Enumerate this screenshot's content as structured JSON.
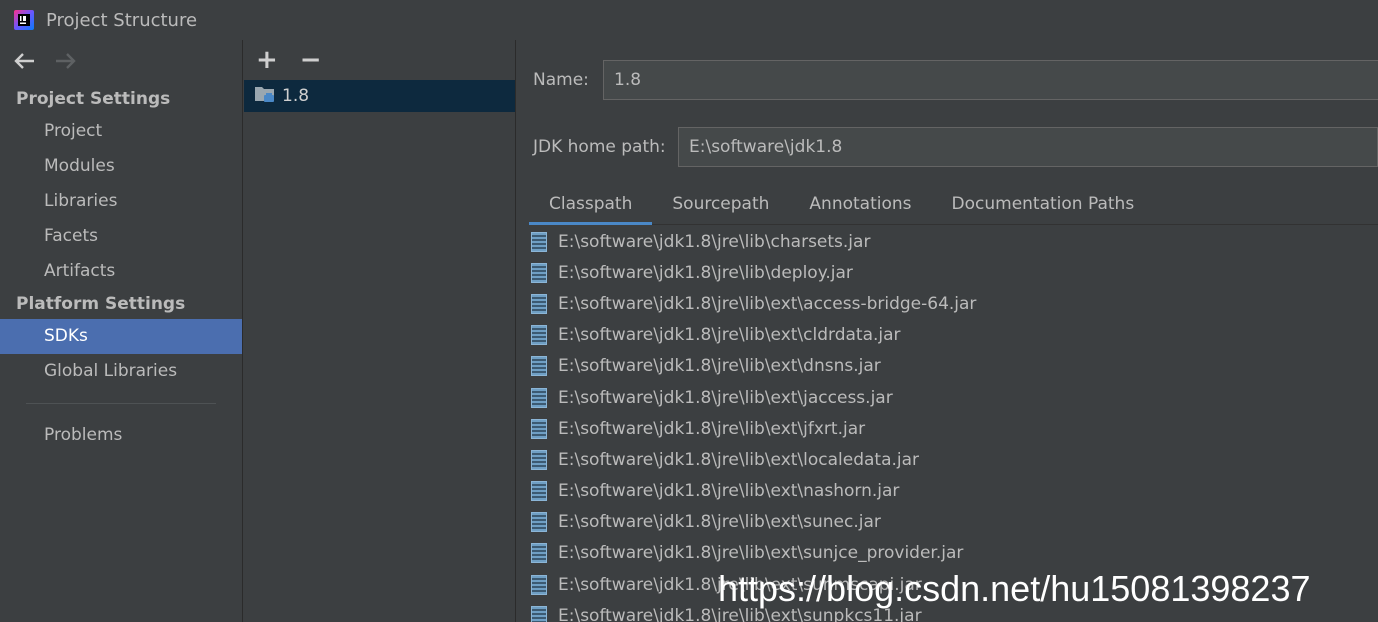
{
  "window": {
    "title": "Project Structure"
  },
  "nav": {
    "back_icon": "arrow-left-icon",
    "forward_icon": "arrow-right-icon",
    "project_settings_label": "Project Settings",
    "project_items": [
      "Project",
      "Modules",
      "Libraries",
      "Facets",
      "Artifacts"
    ],
    "platform_settings_label": "Platform Settings",
    "platform_items": [
      "SDKs",
      "Global Libraries"
    ],
    "selected": "SDKs",
    "problems_label": "Problems"
  },
  "sdk_list": {
    "add_label": "+",
    "remove_label": "−",
    "items": [
      "1.8"
    ]
  },
  "details": {
    "name_label": "Name:",
    "name_value": "1.8",
    "jdk_home_label": "JDK home path:",
    "jdk_home_value": "E:\\software\\jdk1.8"
  },
  "tabs": [
    "Classpath",
    "Sourcepath",
    "Annotations",
    "Documentation Paths"
  ],
  "active_tab": "Classpath",
  "classpath": [
    "E:\\software\\jdk1.8\\jre\\lib\\charsets.jar",
    "E:\\software\\jdk1.8\\jre\\lib\\deploy.jar",
    "E:\\software\\jdk1.8\\jre\\lib\\ext\\access-bridge-64.jar",
    "E:\\software\\jdk1.8\\jre\\lib\\ext\\cldrdata.jar",
    "E:\\software\\jdk1.8\\jre\\lib\\ext\\dnsns.jar",
    "E:\\software\\jdk1.8\\jre\\lib\\ext\\jaccess.jar",
    "E:\\software\\jdk1.8\\jre\\lib\\ext\\jfxrt.jar",
    "E:\\software\\jdk1.8\\jre\\lib\\ext\\localedata.jar",
    "E:\\software\\jdk1.8\\jre\\lib\\ext\\nashorn.jar",
    "E:\\software\\jdk1.8\\jre\\lib\\ext\\sunec.jar",
    "E:\\software\\jdk1.8\\jre\\lib\\ext\\sunjce_provider.jar",
    "E:\\software\\jdk1.8\\jre\\lib\\ext\\sunmscapi.jar",
    "E:\\software\\jdk1.8\\jre\\lib\\ext\\sunpkcs11.jar"
  ],
  "watermark": "https://blog.csdn.net/hu15081398237",
  "colors": {
    "selection": "#4b6eaf",
    "tab_underline": "#4a88c7",
    "list_selection": "#0d293e"
  }
}
